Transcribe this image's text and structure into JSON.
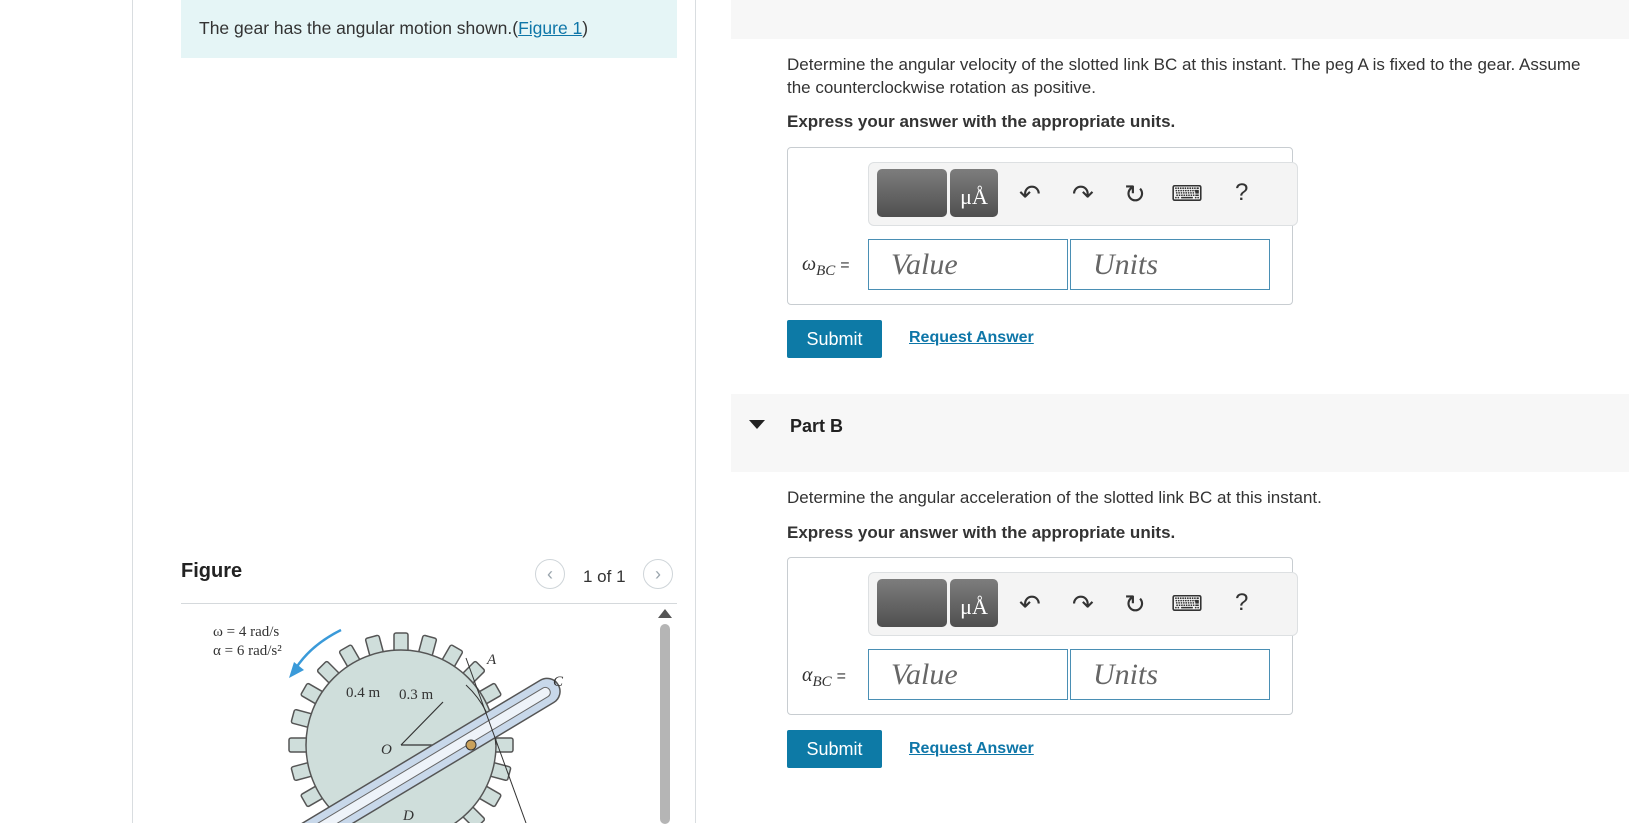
{
  "intro": {
    "text": "The gear has the angular motion shown.(",
    "link": "Figure 1",
    "close": ")"
  },
  "figure": {
    "title": "Figure",
    "pager": "1 of 1",
    "prev_icon": "chevron-left-icon",
    "next_icon": "chevron-right-icon",
    "labels": {
      "omega": "ω = 4 rad/s",
      "alpha": "α = 6 rad/s²",
      "r1": "0.4 m",
      "r2": "0.3 m",
      "O": "O",
      "A": "A",
      "C": "C",
      "D": "D"
    }
  },
  "part_a": {
    "question": "Determine the angular velocity of the slotted link BC at this instant. The peg A is fixed to the gear. Assume",
    "question_line2": "the counterclockwise rotation as positive.",
    "instruction": "Express your answer with the appropriate units.",
    "var_symbol": "ω",
    "var_sub": "BC",
    "equals": "=",
    "value_placeholder": "Value",
    "units_placeholder": "Units",
    "submit": "Submit",
    "request": "Request Answer"
  },
  "part_b": {
    "title": "Part B",
    "question": "Determine the angular acceleration of the slotted link BC at this instant.",
    "instruction": "Express your answer with the appropriate units.",
    "var_symbol": "α",
    "var_sub": "BC",
    "equals": "=",
    "value_placeholder": "Value",
    "units_placeholder": "Units",
    "submit": "Submit",
    "request": "Request Answer"
  },
  "toolbar": {
    "units_glyph": "μÅ",
    "help": "?",
    "icons": [
      "templates-icon",
      "units-icon",
      "undo-icon",
      "redo-icon",
      "reset-icon",
      "keyboard-icon",
      "help-icon"
    ]
  },
  "colors": {
    "accent": "#0d7aa6",
    "link": "#0e76a8",
    "intro_bg": "#e5f5f6",
    "gear": "#cfdedb"
  }
}
